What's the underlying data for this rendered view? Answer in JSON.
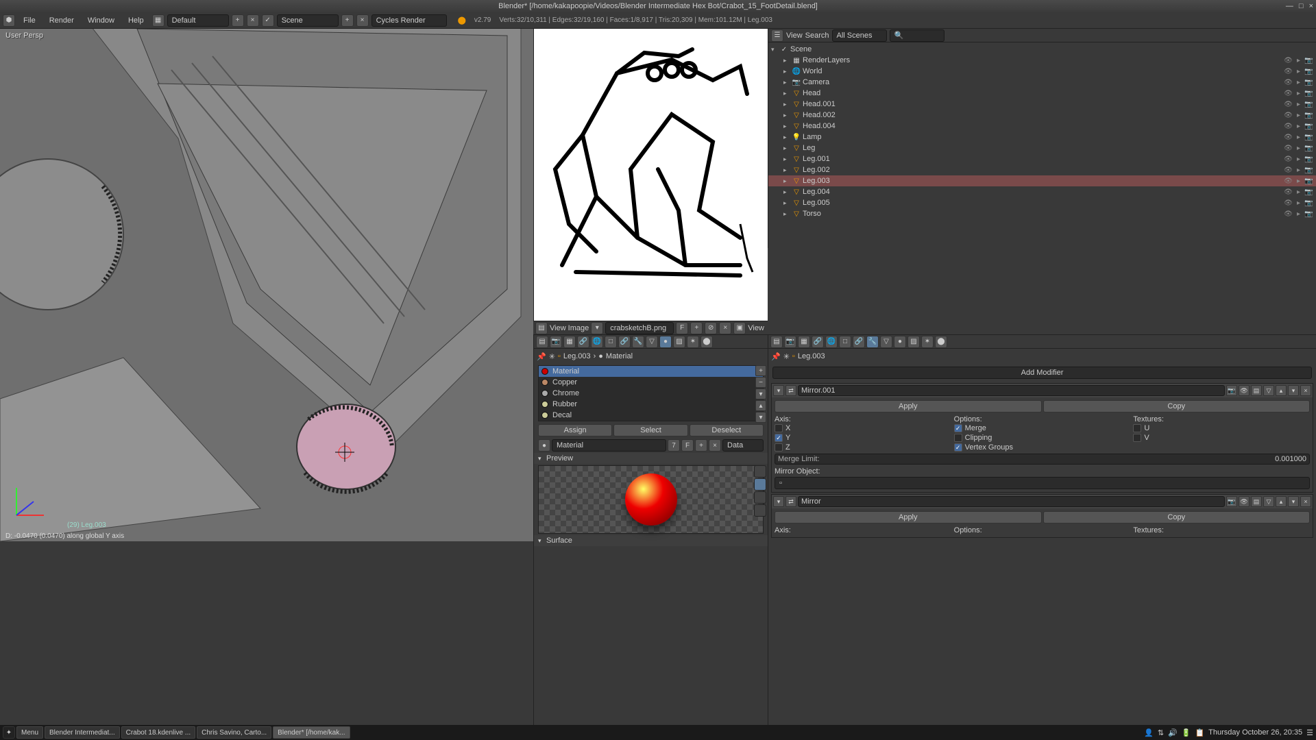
{
  "window": {
    "title": "Blender* [/home/kakapoopie/Videos/Blender Intermediate Hex Bot/Crabot_15_FootDetail.blend]",
    "minimize": "—",
    "maximize": "□",
    "close": "×"
  },
  "topmenu": {
    "items": [
      "File",
      "Render",
      "Window",
      "Help"
    ],
    "layout": "Default",
    "scene": "Scene",
    "engine": "Cycles Render",
    "version": "v2.79",
    "stats": "Verts:32/10,311 | Edges:32/19,160 | Faces:1/8,917 | Tris:20,309 | Mem:101.12M | Leg.003"
  },
  "viewport": {
    "persp": "User Persp",
    "objlabel": "(29) Leg.003",
    "status": "D: -0.0470 (0.0470) along global Y axis"
  },
  "imageview": {
    "menus": [
      "View",
      "Image"
    ],
    "filename": "crabsketchB.png",
    "btn_view": "View"
  },
  "outliner": {
    "menus": [
      "View",
      "Search"
    ],
    "filter": "All Scenes",
    "root": "Scene",
    "items": [
      {
        "name": "RenderLayers",
        "ico": "▦",
        "ind": 1
      },
      {
        "name": "World",
        "ico": "🌐",
        "ind": 1
      },
      {
        "name": "Camera",
        "ico": "📷",
        "ind": 1
      },
      {
        "name": "Head",
        "ico": "▽",
        "ind": 1,
        "c": "#e90"
      },
      {
        "name": "Head.001",
        "ico": "▽",
        "ind": 1,
        "c": "#e90"
      },
      {
        "name": "Head.002",
        "ico": "▽",
        "ind": 1,
        "c": "#e90"
      },
      {
        "name": "Head.004",
        "ico": "▽",
        "ind": 1,
        "c": "#e90"
      },
      {
        "name": "Lamp",
        "ico": "💡",
        "ind": 1
      },
      {
        "name": "Leg",
        "ico": "▽",
        "ind": 1,
        "c": "#e90"
      },
      {
        "name": "Leg.001",
        "ico": "▽",
        "ind": 1,
        "c": "#e90"
      },
      {
        "name": "Leg.002",
        "ico": "▽",
        "ind": 1,
        "c": "#e90"
      },
      {
        "name": "Leg.003",
        "ico": "▽",
        "ind": 1,
        "c": "#e90",
        "sel": true
      },
      {
        "name": "Leg.004",
        "ico": "▽",
        "ind": 1,
        "c": "#e90"
      },
      {
        "name": "Leg.005",
        "ico": "▽",
        "ind": 1,
        "c": "#e90"
      },
      {
        "name": "Torso",
        "ico": "▽",
        "ind": 1,
        "c": "#e90"
      }
    ]
  },
  "material_panel": {
    "crumb_obj": "Leg.003",
    "crumb_mat": "Material",
    "materials": [
      {
        "name": "Material",
        "color": "#c00",
        "sel": true
      },
      {
        "name": "Copper",
        "color": "#b86"
      },
      {
        "name": "Chrome",
        "color": "#aaa"
      },
      {
        "name": "Rubber",
        "color": "#cc9"
      },
      {
        "name": "Decal",
        "color": "#cc9"
      }
    ],
    "assign": "Assign",
    "select": "Select",
    "deselect": "Deselect",
    "name_field": "Material",
    "users": "7",
    "f": "F",
    "data": "Data",
    "preview": "Preview",
    "surface": "Surface"
  },
  "modifier_panel": {
    "crumb_obj": "Leg.003",
    "add": "Add Modifier",
    "mods": [
      {
        "name": "Mirror.001",
        "apply": "Apply",
        "copy": "Copy",
        "axis_label": "Axis:",
        "options_label": "Options:",
        "textures_label": "Textures:",
        "x": "X",
        "y": "Y",
        "z": "Z",
        "merge": "Merge",
        "clipping": "Clipping",
        "vgroups": "Vertex Groups",
        "u": "U",
        "v": "V",
        "merge_limit_label": "Merge Limit:",
        "merge_limit": "0.001000",
        "mirror_obj": "Mirror Object:"
      },
      {
        "name": "Mirror",
        "apply": "Apply",
        "copy": "Copy",
        "axis_label": "Axis:",
        "options_label": "Options:",
        "textures_label": "Textures:"
      }
    ]
  },
  "taskbar": {
    "menu": "Menu",
    "items": [
      {
        "label": "Blender Intermediat..."
      },
      {
        "label": "Crabot 18.kdenlive ..."
      },
      {
        "label": "Chris Savino, Carto..."
      },
      {
        "label": "Blender* [/home/kak...",
        "active": true
      }
    ],
    "clock": "Thursday October 26, 20:35"
  }
}
